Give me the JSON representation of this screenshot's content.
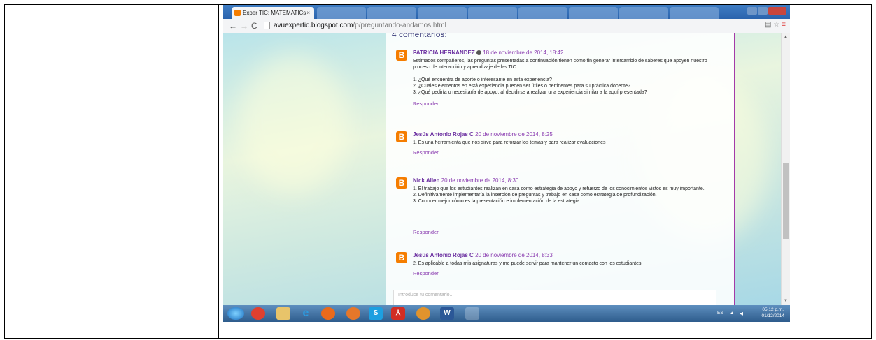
{
  "browser": {
    "active_tab_title": "Exper TIC: MATEMATICs",
    "close_glyph": "×",
    "url_host": "avuexpertic.blogspot.com",
    "url_path": "/p/preguntando-andamos.html"
  },
  "page": {
    "comments_count_label": "4 comentarios:",
    "comments": [
      {
        "author": "PATRICIA HERNANDEZ",
        "date": "18 de noviembre de 2014, 18:42",
        "body": [
          "Estimados compañeros, las preguntas presentadas a continuación tienen como fin generar intercambio de saberes que apoyen nuestro proceso de interacción y aprendizaje de las TIC.",
          "",
          "1. ¿Qué encuentra de aporte o interesante en esta experiencia?",
          "2. ¿Cuales elementos en está experiencia pueden ser útiles o pertinentes para su práctica docente?",
          "3. ¿Qué pediría o necesitaría de apoyo, al decidirse a realizar una experiencia similar a la aquí presentada?"
        ],
        "reply_label": "Responder"
      },
      {
        "author": "Jesús Antonio Rojas C",
        "date": "20 de noviembre de 2014, 8:25",
        "body": [
          "1. Es una herramienta que nos sirve para reforzar los temas y para realizar evaluaciones"
        ],
        "reply_label": "Responder"
      },
      {
        "author": "Nick Allen",
        "date": "20 de noviembre de 2014, 8:30",
        "body": [
          "1. El trabajo que los estudiantes realizan en casa como estrategia de apoyo y refuerzo de los conocimientos vistos es muy importante.",
          "2. Definitivamente implementaría la inserción de preguntas y trabajo en casa como estrategia de profundización.",
          "3. Conocer mejor cómo es la presentación e implementación de la estrategia."
        ],
        "reply_label": "Responder"
      },
      {
        "author": "Jesús Antonio Rojas C",
        "date": "20 de noviembre de 2014, 8:33",
        "body": [
          "2. Es aplicable a todas mis asignaturas y me puede servir para mantener un contacto con los estudiantes"
        ],
        "reply_label": "Responder"
      }
    ],
    "comment_box_placeholder": "Introduce tu comentario..."
  },
  "taskbar": {
    "language": "ES",
    "time": "05:12 p.m.",
    "date": "01/12/2014"
  },
  "colors": {
    "blogger_orange": "#f57d00",
    "author_purple": "#6b2fa0",
    "accent_purple": "#8a3cb0"
  }
}
